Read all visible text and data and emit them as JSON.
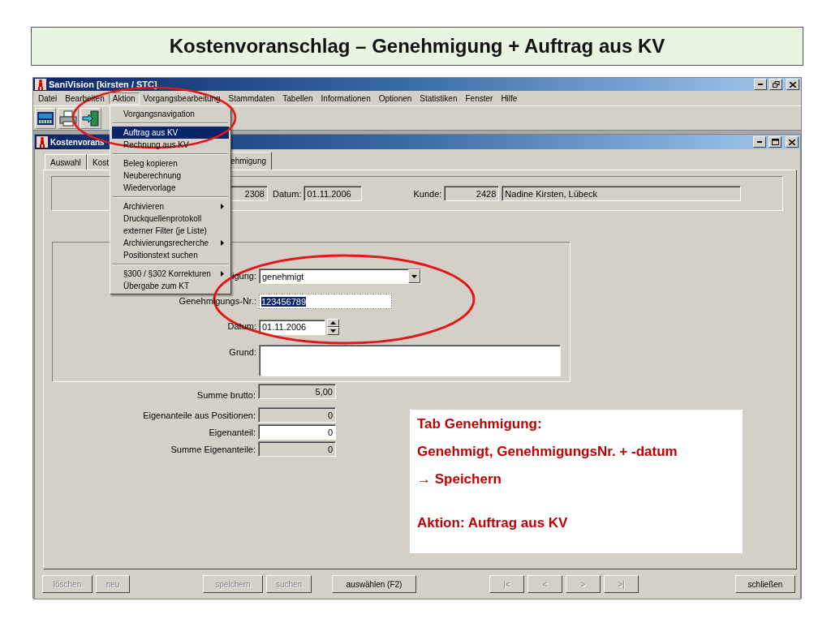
{
  "slide_title": "Kostenvoranschlag – Genehmigung + Auftrag aus KV",
  "app_window": {
    "title": "SaniVision [kirsten / STC]"
  },
  "menu_bar": [
    {
      "label": "Datei",
      "selected": false
    },
    {
      "label": "Bearbeiten",
      "selected": false
    },
    {
      "label": "Aktion",
      "selected": true
    },
    {
      "label": "Vorgangsbearbeitung",
      "selected": false
    },
    {
      "label": "Stammdaten",
      "selected": false
    },
    {
      "label": "Tabellen",
      "selected": false
    },
    {
      "label": "Informationen",
      "selected": false
    },
    {
      "label": "Optionen",
      "selected": false
    },
    {
      "label": "Statistiken",
      "selected": false
    },
    {
      "label": "Fenster",
      "selected": false
    },
    {
      "label": "Hilfe",
      "selected": false
    }
  ],
  "open_menu": [
    {
      "kind": "item",
      "label": "Vorgangsnavigation",
      "selected": false,
      "submenu": false
    },
    {
      "kind": "separator"
    },
    {
      "kind": "item",
      "label": "Auftrag aus KV",
      "selected": true,
      "submenu": false
    },
    {
      "kind": "item",
      "label": "Rechnung aus KV",
      "selected": false,
      "submenu": false
    },
    {
      "kind": "separator"
    },
    {
      "kind": "item",
      "label": "Beleg kopieren",
      "selected": false,
      "submenu": false
    },
    {
      "kind": "item",
      "label": "Neuberechnung",
      "selected": false,
      "submenu": false
    },
    {
      "kind": "item",
      "label": "Wiedervorlage",
      "selected": false,
      "submenu": false
    },
    {
      "kind": "separator"
    },
    {
      "kind": "item",
      "label": "Archivieren",
      "selected": false,
      "submenu": true
    },
    {
      "kind": "item",
      "label": "Druckquellenprotokoll",
      "selected": false,
      "submenu": false
    },
    {
      "kind": "item",
      "label": "externer Filter (je Liste)",
      "selected": false,
      "submenu": false
    },
    {
      "kind": "item",
      "label": "Archivierungsrecherche",
      "selected": false,
      "submenu": true
    },
    {
      "kind": "item",
      "label": "Positionstext suchen",
      "selected": false,
      "submenu": false
    },
    {
      "kind": "separator"
    },
    {
      "kind": "item",
      "label": "§300 / §302 Korrekturen",
      "selected": false,
      "submenu": true
    },
    {
      "kind": "item",
      "label": "Übergabe zum KT",
      "selected": false,
      "submenu": false
    }
  ],
  "child_window": {
    "title": "Kostenvorans"
  },
  "tabs": [
    {
      "label": "Auswahl",
      "selected": false
    },
    {
      "label": "Kost",
      "selected": false
    },
    {
      "label": "ehmigung",
      "selected": true
    }
  ],
  "header": {
    "number": "2308",
    "date_label": "Datum:",
    "date": "01.11.2006",
    "customer_label": "Kunde:",
    "customer_number": "2428",
    "customer_name": "Nadine Kirsten, Lübeck"
  },
  "approval_fields": [
    {
      "kind": "combo",
      "label": "igung:",
      "value": "genehmigt",
      "highlighted": false
    },
    {
      "kind": "text",
      "label": "Genehmigungs-Nr.:",
      "value": "123456789",
      "highlighted": true
    },
    {
      "kind": "spin",
      "label": "Datum:",
      "value": "01.11.2006",
      "highlighted": false
    },
    {
      "kind": "memo",
      "label": "Grund:",
      "highlighted": false
    }
  ],
  "totals": [
    {
      "label": "Summe brutto:",
      "value": "5,00",
      "editable": false
    },
    {
      "label": "Eigenanteile aus Positionen:",
      "value": "0",
      "editable": false
    },
    {
      "label": "Eigenanteil:",
      "value": "0",
      "editable": true
    },
    {
      "label": "Summe Eigenanteile:",
      "value": "0",
      "editable": false
    }
  ],
  "button_groups": [
    [
      {
        "label": "löschen",
        "disabled": true
      },
      {
        "label": "neu",
        "disabled": true
      }
    ],
    [
      {
        "label": "speichern",
        "disabled": true
      },
      {
        "label": "suchen",
        "disabled": true
      }
    ],
    [
      {
        "label": "auswählen (F2)",
        "disabled": false
      }
    ],
    [
      {
        "label": "|<",
        "disabled": true
      },
      {
        "label": "<",
        "disabled": true
      },
      {
        "label": ">",
        "disabled": true
      },
      {
        "label": ">|",
        "disabled": true
      }
    ],
    [
      {
        "label": "schließen",
        "disabled": false
      }
    ]
  ],
  "note": {
    "paragraphs": [
      [
        "Tab Genehmigung:",
        "Genehmigt, GenehmigungsNr. + -datum",
        "→ Speichern"
      ],
      [
        "Aktion: Auftrag aus KV"
      ]
    ]
  }
}
